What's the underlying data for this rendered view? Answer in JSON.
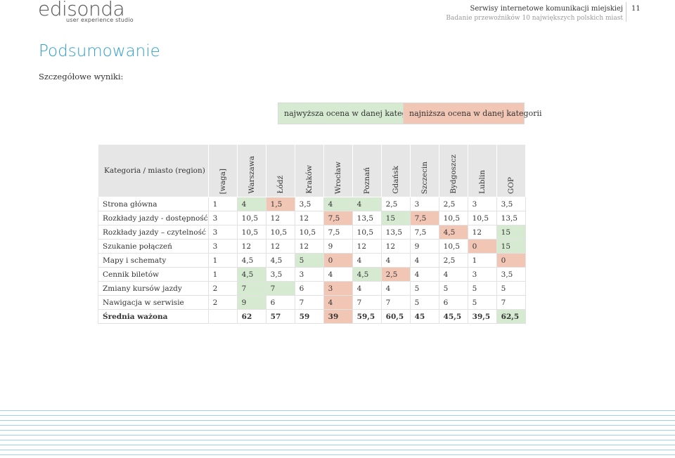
{
  "header": {
    "logo_word": "edisonda",
    "logo_sub": "user experience studio",
    "title": "Serwisy internetowe komunikacji miejskiej",
    "subtitle": "Badanie przewoźników 10 największych polskich miast",
    "page": "11"
  },
  "page_title": "Podsumowanie",
  "subtitle": "Szczegółowe wyniki:",
  "legend": {
    "high": "najwyższa ocena w danej kategorii",
    "low": "najniższa ocena w danej kategorii"
  },
  "colors": {
    "high": "#d5ead1",
    "low": "#f2c6b4",
    "accent": "#2f9fd0"
  },
  "table": {
    "corner": "Kategoria / miasto (region)",
    "columns": [
      "[waga]",
      "Warszawa",
      "Łódź",
      "Kraków",
      "Wrocław",
      "Poznań",
      "Gdańsk",
      "Szczecin",
      "Bydgoszcz",
      "Lublin",
      "GOP"
    ],
    "rows": [
      {
        "label": "Strona główna",
        "cells": [
          "1",
          "4",
          "1,5",
          "3,5",
          "4",
          "4",
          "2,5",
          "3",
          "2,5",
          "3",
          "3,5"
        ],
        "marks": [
          "",
          "hi",
          "lo",
          "",
          "hi",
          "hi",
          "",
          "",
          "",
          "",
          ""
        ]
      },
      {
        "label": "Rozkłady jazdy - dostępność",
        "cells": [
          "3",
          "10,5",
          "12",
          "12",
          "7,5",
          "13,5",
          "15",
          "7,5",
          "10,5",
          "10,5",
          "13,5"
        ],
        "marks": [
          "",
          "",
          "",
          "",
          "lo",
          "",
          "hi",
          "lo",
          "",
          "",
          ""
        ]
      },
      {
        "label": "Rozkłady jazdy – czytelność",
        "cells": [
          "3",
          "10,5",
          "10,5",
          "10,5",
          "7,5",
          "10,5",
          "13,5",
          "7,5",
          "4,5",
          "12",
          "15"
        ],
        "marks": [
          "",
          "",
          "",
          "",
          "",
          "",
          "",
          "",
          "lo",
          "",
          "hi"
        ]
      },
      {
        "label": "Szukanie połączeń",
        "cells": [
          "3",
          "12",
          "12",
          "12",
          "9",
          "12",
          "12",
          "9",
          "10,5",
          "0",
          "15"
        ],
        "marks": [
          "",
          "",
          "",
          "",
          "",
          "",
          "",
          "",
          "",
          "lo",
          "hi"
        ]
      },
      {
        "label": "Mapy i schematy",
        "cells": [
          "1",
          "4,5",
          "4,5",
          "5",
          "0",
          "4",
          "4",
          "4",
          "2,5",
          "1",
          "0"
        ],
        "marks": [
          "",
          "",
          "",
          "hi",
          "lo",
          "",
          "",
          "",
          "",
          "",
          "lo"
        ]
      },
      {
        "label": "Cennik biletów",
        "cells": [
          "1",
          "4,5",
          "3,5",
          "3",
          "4",
          "4,5",
          "2,5",
          "4",
          "4",
          "3",
          "3,5"
        ],
        "marks": [
          "",
          "hi",
          "",
          "",
          "",
          "hi",
          "lo",
          "",
          "",
          "",
          ""
        ]
      },
      {
        "label": "Zmiany kursów jazdy",
        "cells": [
          "2",
          "7",
          "7",
          "6",
          "3",
          "4",
          "4",
          "5",
          "5",
          "5",
          "5"
        ],
        "marks": [
          "",
          "hi",
          "hi",
          "",
          "lo",
          "",
          "",
          "",
          "",
          "",
          ""
        ]
      },
      {
        "label": "Nawigacja w serwisie",
        "cells": [
          "2",
          "9",
          "6",
          "7",
          "4",
          "7",
          "7",
          "5",
          "6",
          "5",
          "7"
        ],
        "marks": [
          "",
          "hi",
          "",
          "",
          "lo",
          "",
          "",
          "",
          "",
          "",
          ""
        ]
      }
    ],
    "total": {
      "label": "Średnia ważona",
      "cells": [
        "",
        "62",
        "57",
        "59",
        "39",
        "59,5",
        "60,5",
        "45",
        "45,5",
        "39,5",
        "62,5"
      ],
      "marks": [
        "",
        "",
        "",
        "",
        "lo",
        "",
        "",
        "",
        "",
        "",
        "hi"
      ]
    }
  }
}
